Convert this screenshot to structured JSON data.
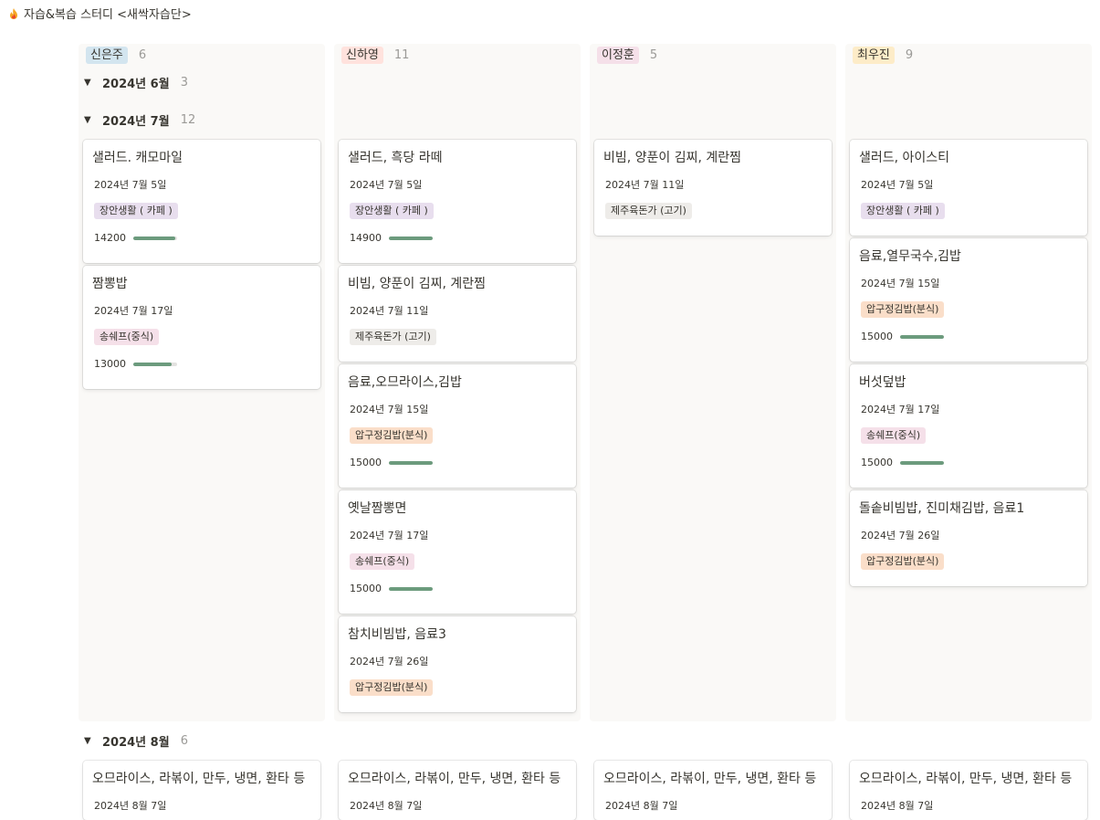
{
  "page": {
    "title": "자습&복습 스터디 <새싹자습단>",
    "icon": "fire-icon"
  },
  "colors": {
    "blue": "#d3e5ef",
    "red": "#ffe2dd",
    "pink": "#f5e0e9",
    "orange": "#fadec9",
    "purple": "#e8deee",
    "gray": "#e3e2e0",
    "yellow": "#fdecc8",
    "bar": "#6c9b7d"
  },
  "columns": [
    {
      "name": "신은주",
      "count": "6",
      "color": "#d3e5ef"
    },
    {
      "name": "신하영",
      "count": "11",
      "color": "#ffe2dd"
    },
    {
      "name": "이정훈",
      "count": "5",
      "color": "#f5e0e9"
    },
    {
      "name": "최우진",
      "count": "9",
      "color": "#fdecc8"
    }
  ],
  "groups": [
    {
      "label": "2024년 6월",
      "count": "3"
    },
    {
      "label": "2024년 7월",
      "count": "12"
    },
    {
      "label": "2024년 8월",
      "count": "6"
    }
  ],
  "cards": [
    {
      "title": "샐러드. 캐모마일",
      "date": "2024년 7월 5일",
      "tag": "장안생활 ( 카페 )",
      "tag_color": "#e8deee",
      "price": "14200",
      "fill": 0.95
    },
    {
      "title": "짬뽕밥",
      "date": "2024년 7월 17일",
      "tag": "송쉐프(중식)",
      "tag_color": "#f5e0e9",
      "price": "13000",
      "fill": 0.87
    },
    {
      "title": "샐러드, 흑당 라떼",
      "date": "2024년 7월 5일",
      "tag": "장안생활 ( 카페 )",
      "tag_color": "#e8deee",
      "price": "14900",
      "fill": 0.99
    },
    {
      "title": "비빔, 양푼이 김찌, 계란찜",
      "date": "2024년 7월 11일",
      "tag": "제주육돈가 (고기)",
      "tag_color": "#eeece9"
    },
    {
      "title": "음료,오므라이스,김밥",
      "date": "2024년 7월 15일",
      "tag": "압구정김밥(분식)",
      "tag_color": "#fadec9",
      "price": "15000",
      "fill": 1.0
    },
    {
      "title": "옛날짬뽕면",
      "date": "2024년 7월 17일",
      "tag": "송쉐프(중식)",
      "tag_color": "#f5e0e9",
      "price": "15000",
      "fill": 1.0
    },
    {
      "title": "참치비빔밥, 음료3",
      "date": "2024년 7월 26일",
      "tag": "압구정김밥(분식)",
      "tag_color": "#fadec9"
    },
    {
      "title": "비빔, 양푼이 김찌, 계란찜",
      "date": "2024년 7월 11일",
      "tag": "제주육돈가 (고기)",
      "tag_color": "#eeece9"
    },
    {
      "title": "샐러드, 아이스티",
      "date": "2024년 7월 5일",
      "tag": "장안생활 ( 카페 )",
      "tag_color": "#e8deee"
    },
    {
      "title": "음료,열무국수,김밥",
      "date": "2024년 7월 15일",
      "tag": "압구정김밥(분식)",
      "tag_color": "#fadec9",
      "price": "15000",
      "fill": 1.0
    },
    {
      "title": "버섯덮밥",
      "date": "2024년 7월 17일",
      "tag": "송쉐프(중식)",
      "tag_color": "#f5e0e9",
      "price": "15000",
      "fill": 1.0
    },
    {
      "title": "돌솥비빔밥, 진미채김밥, 음료1",
      "date": "2024년 7월 26일",
      "tag": "압구정김밥(분식)",
      "tag_color": "#fadec9"
    },
    {
      "title": "오므라이스, 라볶이, 만두, 냉면, 환타 등",
      "date": "2024년 8월 7일"
    },
    {
      "title": "오므라이스, 라볶이, 만두, 냉면, 환타 등",
      "date": "2024년 8월 7일"
    },
    {
      "title": "오므라이스, 라볶이, 만두, 냉면, 환타 등",
      "date": "2024년 8월 7일"
    },
    {
      "title": "오므라이스, 라볶이, 만두, 냉면, 환타 등",
      "date": "2024년 8월 7일"
    }
  ]
}
